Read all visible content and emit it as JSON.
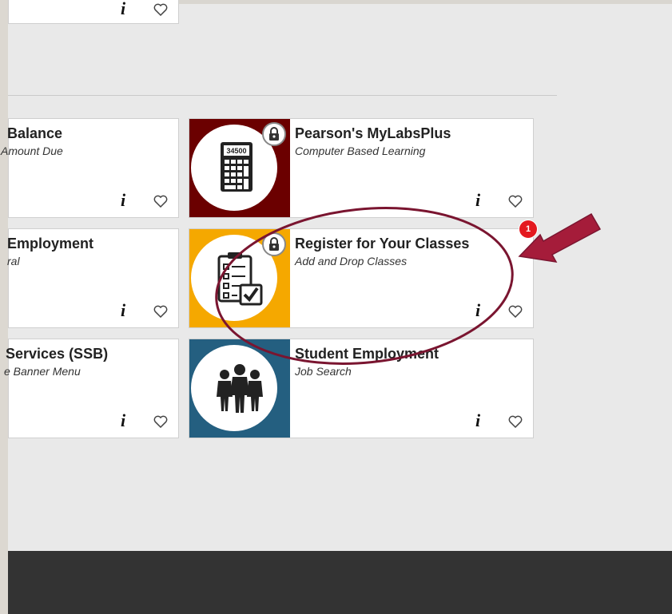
{
  "tiles": {
    "top_partial": {},
    "balance": {
      "title": "Balance",
      "subtitle": "Amount Due"
    },
    "employment": {
      "title": "Employment",
      "subtitle": "ral"
    },
    "services": {
      "title": "Services (SSB)",
      "subtitle": "e Banner Menu"
    },
    "pearson": {
      "title": "Pearson's MyLabsPlus",
      "subtitle": "Computer Based Learning",
      "image_text": "34500",
      "image_bg": "#6b0000"
    },
    "register": {
      "title": "Register for Your Classes",
      "subtitle": "Add and Drop Classes",
      "image_bg": "#f5a800"
    },
    "student_employment": {
      "title": "Student Employment",
      "subtitle": "Job Search",
      "image_bg": "#245f80"
    }
  },
  "notification": {
    "count": "1"
  },
  "icons": {
    "info": "i",
    "favorite": "heart-outline-icon",
    "lock": "lock-icon",
    "calculator": "calculator-icon",
    "clipboard": "clipboard-checklist-icon",
    "people": "people-group-icon"
  },
  "annotation": {
    "ellipse_color": "#7a1530",
    "arrow_color": "#a51c3a"
  }
}
